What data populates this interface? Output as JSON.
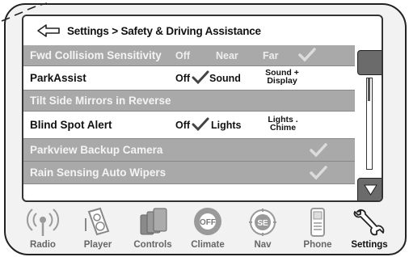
{
  "header": {
    "title": "Settings > Safety  & Driving Assistance"
  },
  "rows": [
    {
      "label": "Fwd Collisiom Sensitivity",
      "opt1": "Off",
      "opt2": "Near",
      "opt3": "Far"
    },
    {
      "label": "ParkAssist",
      "opt1": "Off",
      "opt2": "Sound",
      "opt3a": "Sound +",
      "opt3b": "Display"
    },
    {
      "label": "Tilt Side Mirrors in Reverse"
    },
    {
      "label": "Blind Spot Alert",
      "opt1": "Off",
      "opt2": "Lights",
      "opt3a": "Lights .",
      "opt3b": "Chime"
    },
    {
      "label": "Parkview Backup Camera"
    },
    {
      "label": "Rain Sensing Auto Wipers"
    }
  ],
  "dock": [
    {
      "label": "Radio",
      "icon": "radio-icon"
    },
    {
      "label": "Player",
      "icon": "player-icon"
    },
    {
      "label": "Controls",
      "icon": "controls-icon"
    },
    {
      "label": "Climate",
      "icon": "climate-icon",
      "badge": "OFF"
    },
    {
      "label": "Nav",
      "icon": "nav-icon",
      "badge": "SE"
    },
    {
      "label": "Phone",
      "icon": "phone-icon"
    },
    {
      "label": "Settings",
      "icon": "settings-icon",
      "active": true
    }
  ],
  "colors": {
    "gray_row": "#a9a9a9",
    "scroll_button": "#6b6b6b",
    "dock_icon": "#9a9a9a"
  }
}
